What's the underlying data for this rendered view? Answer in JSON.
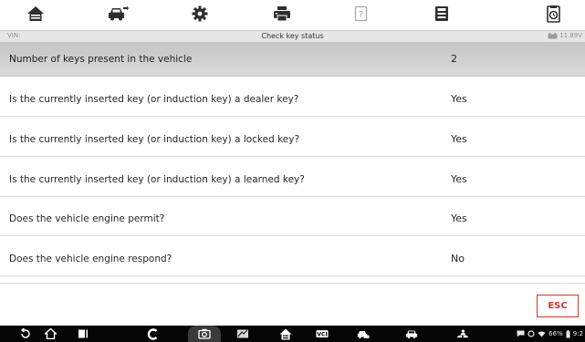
{
  "header": {
    "vin_label": "VIN:",
    "title": "Check key status",
    "battery_voltage": "11.89V"
  },
  "toolbar": {
    "items": [
      {
        "icon": "home-icon"
      },
      {
        "icon": "vehicle-swap-icon"
      },
      {
        "icon": "gear-icon"
      },
      {
        "icon": "printer-icon"
      },
      {
        "icon": "help-icon"
      },
      {
        "icon": "save-icon"
      },
      {
        "icon": "data-logging-icon"
      }
    ]
  },
  "table": {
    "rows": [
      {
        "question": "Number of keys present in the vehicle",
        "answer": "2"
      },
      {
        "question": "Is the currently inserted key (or induction key) a dealer key?",
        "answer": "Yes"
      },
      {
        "question": "Is the currently inserted key (or induction key) a locked key?",
        "answer": "Yes"
      },
      {
        "question": "Is the currently inserted key (or induction key) a learned key?",
        "answer": "Yes"
      },
      {
        "question": "Does the vehicle engine permit?",
        "answer": "Yes"
      },
      {
        "question": "Does the vehicle engine respond?",
        "answer": "No"
      }
    ]
  },
  "actions": {
    "esc_label": "ESC"
  },
  "system_bar": {
    "battery_percent": "66%",
    "clock": "9:2"
  },
  "colors": {
    "accent": "#d8342c",
    "header_row": "#cfcfcf",
    "navbar": "#050505"
  }
}
